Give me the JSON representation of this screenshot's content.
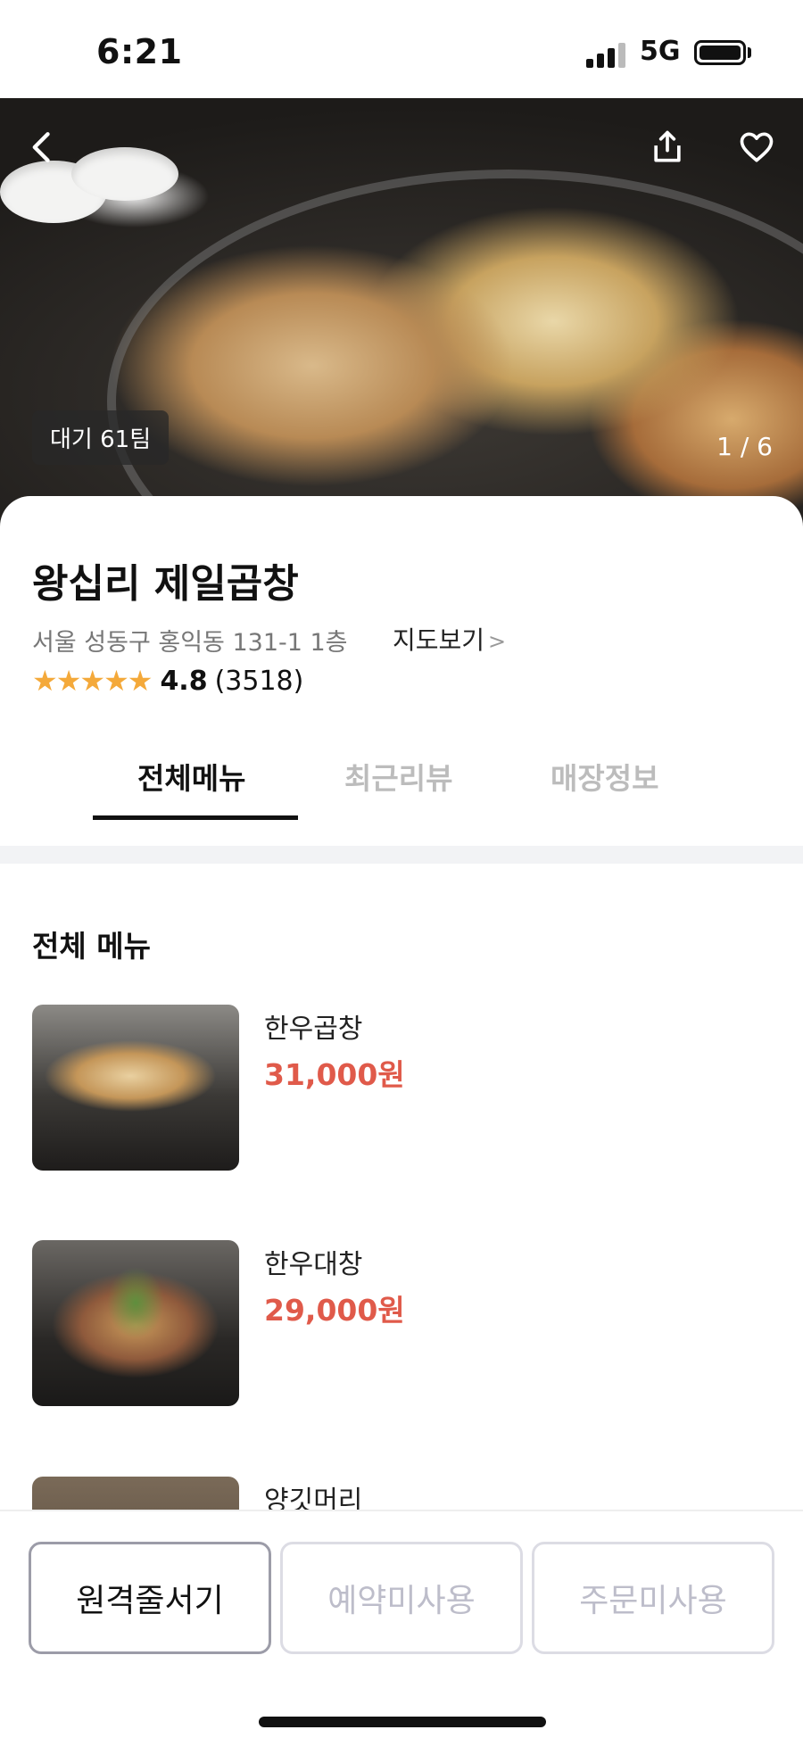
{
  "status_bar": {
    "time": "6:21",
    "network": "5G",
    "signal_icon": "signal-bars-icon",
    "battery_icon": "battery-icon"
  },
  "hero": {
    "back_icon": "chevron-left-icon",
    "share_icon": "share-icon",
    "like_icon": "heart-outline-icon",
    "wait_badge": "대기 61팀",
    "counter": "1 / 6"
  },
  "store": {
    "name": "왕십리 제일곱창",
    "address": "서울 성동구 홍익동 131-1 1층",
    "map_link": "지도보기",
    "map_link_chevron": ">",
    "stars": "★★★★★",
    "rating": "4.8",
    "review_count": "(3518)"
  },
  "tabs": [
    {
      "label": "전체메뉴",
      "active": true
    },
    {
      "label": "최근리뷰",
      "active": false
    },
    {
      "label": "매장정보",
      "active": false
    }
  ],
  "menu": {
    "title": "전체 메뉴",
    "items": [
      {
        "name": "한우곱창",
        "price": "31,000원"
      },
      {
        "name": "한우대창",
        "price": "29,000원"
      },
      {
        "name": "양깃머리",
        "price": ""
      }
    ]
  },
  "bottom_bar": {
    "buttons": [
      {
        "label": "원격줄서기",
        "enabled": true
      },
      {
        "label": "예약미사용",
        "enabled": false
      },
      {
        "label": "주문미사용",
        "enabled": false
      }
    ]
  },
  "colors": {
    "price": "#e05a4a",
    "star": "#f4a93a",
    "tab_inactive": "#bcbcbc"
  }
}
